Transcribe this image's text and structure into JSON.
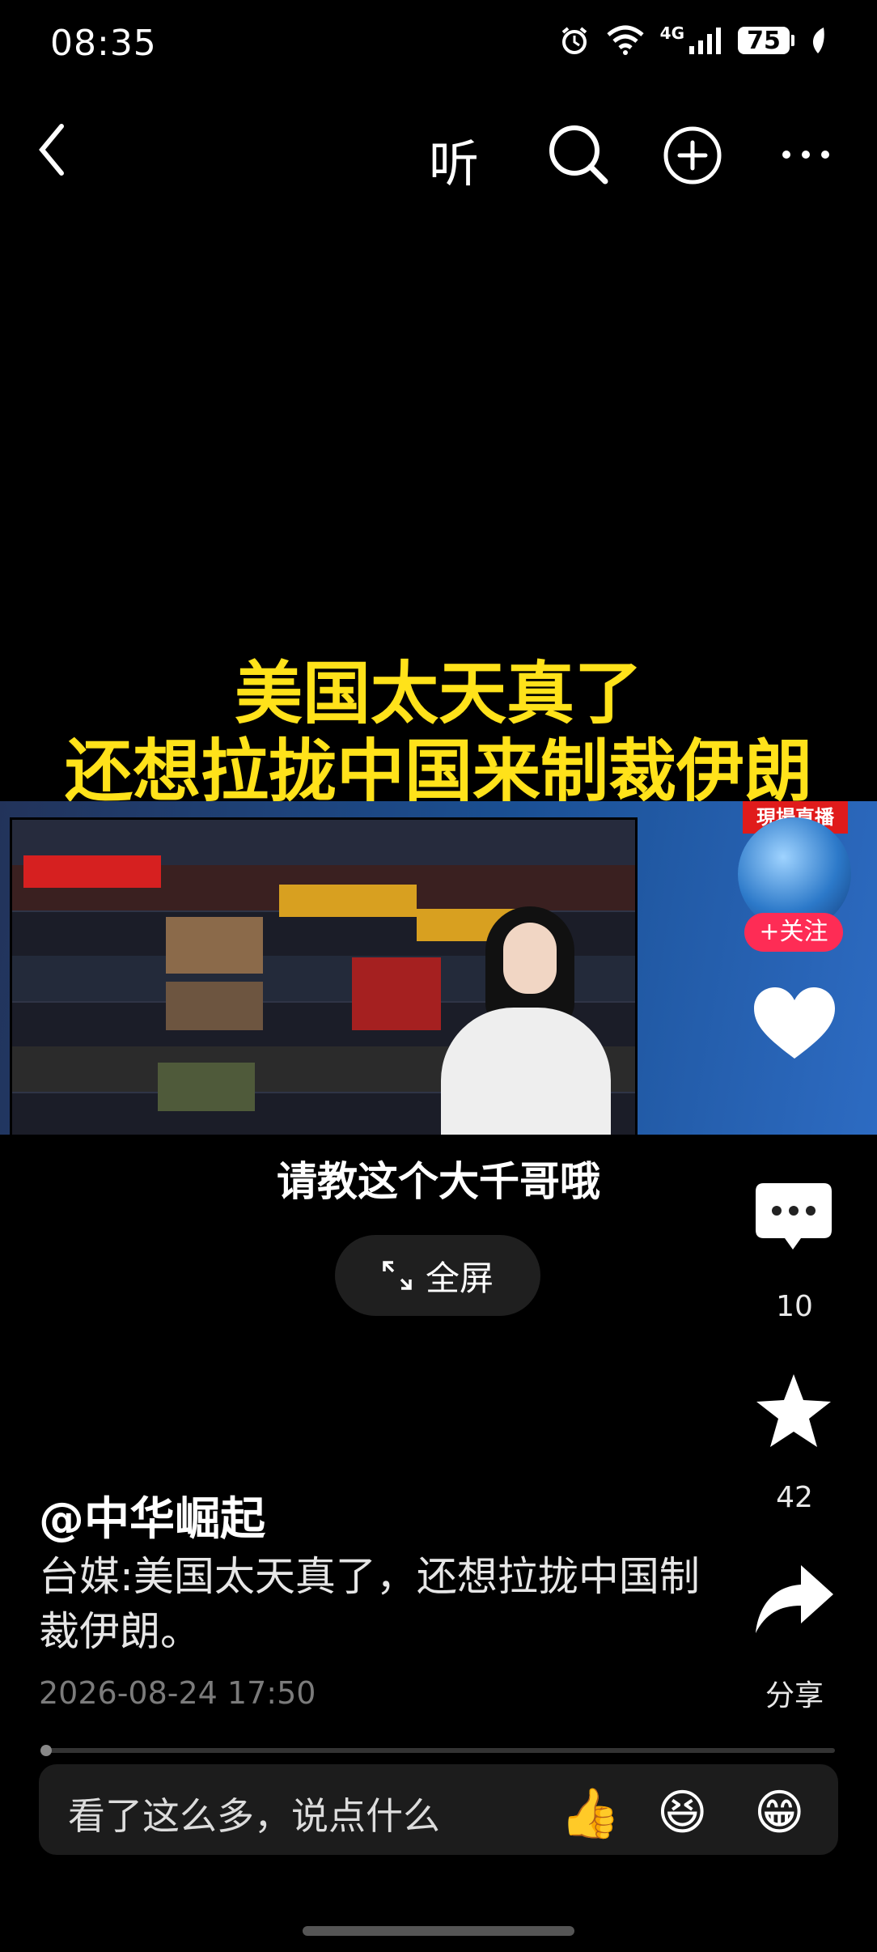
{
  "status_bar": {
    "time": "08:35",
    "network": "4G",
    "battery": "75",
    "icons": [
      "alarm-icon",
      "wifi-icon",
      "signal-icon",
      "battery-icon",
      "leaf-icon"
    ]
  },
  "top_bar": {
    "back_icon": "chevron-left-icon",
    "listen_label": "听",
    "search_icon": "search-icon",
    "add_icon": "plus-circle-icon",
    "more_icon": "more-horizontal-icon"
  },
  "video": {
    "headline_line1": "美国太天真了",
    "headline_line2": "还想拉拢中国来制裁伊朗",
    "live_badge": "現場直播",
    "subtitle": "请教这个大千哥哦",
    "fullscreen_label": "全屏"
  },
  "side_actions": {
    "follow_label": "+关注",
    "like_icon": "heart-icon",
    "comment_count": "10",
    "favorite_count": "42",
    "share_label": "分享"
  },
  "post": {
    "author": "@中华崛起",
    "description": "台媒:美国太天真了，还想拉拢中国制裁伊朗。",
    "date": "2026-08-24 17:50"
  },
  "comment_input": {
    "placeholder": "看了这么多，说点什么",
    "emojis": [
      "👍",
      "😆",
      "😁"
    ]
  },
  "colors": {
    "headline": "#ffe21a",
    "follow": "#fe2c55",
    "background": "#000000"
  }
}
